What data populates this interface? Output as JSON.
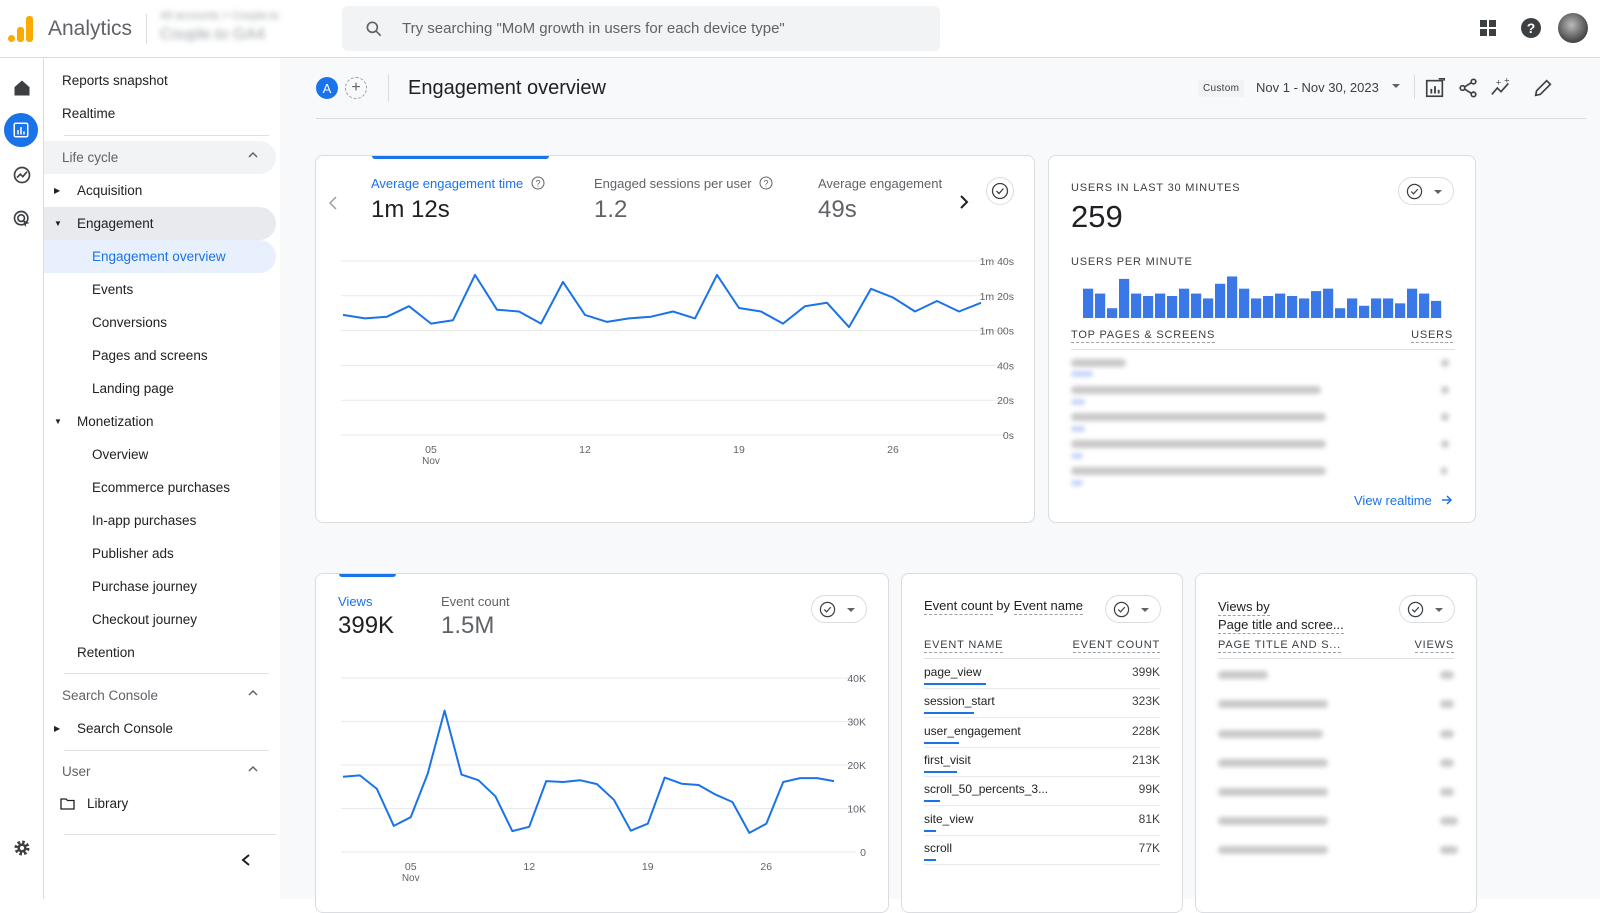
{
  "topbar": {
    "app_title": "Analytics",
    "account_line1": "All accounts > Couple.to",
    "account_line2": "Couple.to GA4",
    "search_placeholder": "Try searching \"MoM growth in users for each device type\"",
    "icons": [
      "apps-grid-icon",
      "help-icon",
      "user-avatar"
    ]
  },
  "rail": {
    "items": [
      {
        "name": "home",
        "active": false
      },
      {
        "name": "reports",
        "active": true
      },
      {
        "name": "explore",
        "active": false
      },
      {
        "name": "advertising",
        "active": false
      }
    ],
    "settings_icon": "gear-icon"
  },
  "sidenav": {
    "top_items": [
      "Reports snapshot",
      "Realtime"
    ],
    "sections": [
      {
        "title": "Life cycle",
        "items": [
          {
            "label": "Acquisition",
            "expanded": false
          },
          {
            "label": "Engagement",
            "expanded": true,
            "children": [
              "Engagement overview",
              "Events",
              "Conversions",
              "Pages and screens",
              "Landing page"
            ]
          },
          {
            "label": "Monetization",
            "expanded": true,
            "children": [
              "Overview",
              "Ecommerce purchases",
              "In-app purchases",
              "Publisher ads",
              "Purchase journey",
              "Checkout journey"
            ]
          },
          {
            "label": "Retention"
          }
        ]
      },
      {
        "title": "Search Console",
        "items": [
          {
            "label": "Search Console",
            "expanded": false
          }
        ]
      },
      {
        "title": "User",
        "items": [
          {
            "label": "Library"
          }
        ]
      }
    ],
    "selected": "Engagement overview"
  },
  "header": {
    "comparison_chip": "A",
    "page_title": "Engagement overview",
    "date_tag": "Custom",
    "date_range": "Nov 1 - Nov 30, 2023"
  },
  "engagement_card": {
    "metrics": [
      {
        "label": "Average engagement time",
        "value": "1m 12s",
        "active": true
      },
      {
        "label": "Engaged sessions per user",
        "value": "1.2",
        "active": false
      },
      {
        "label": "Average engagement",
        "value": "49s",
        "active": false
      }
    ]
  },
  "realtime_card": {
    "title": "USERS IN LAST 30 MINUTES",
    "value": "259",
    "subtitle": "USERS PER MINUTE",
    "table_col1": "TOP PAGES & SCREENS",
    "table_col2": "USERS",
    "link": "View realtime",
    "per_minute": [
      6,
      5,
      2,
      8,
      5,
      4.5,
      5,
      4.5,
      6,
      5,
      4,
      7,
      8.5,
      6,
      4,
      4.5,
      5,
      4.5,
      4,
      5.5,
      6,
      2,
      4,
      2.5,
      4,
      4,
      3,
      6,
      5,
      3.5
    ]
  },
  "views_card": {
    "metrics": [
      {
        "label": "Views",
        "value": "399K",
        "active": true
      },
      {
        "label": "Event count",
        "value": "1.5M",
        "active": false
      }
    ]
  },
  "events_card": {
    "title_part1": "Event count",
    "title_by": "by",
    "title_part2": "Event name",
    "col1": "EVENT NAME",
    "col2": "EVENT COUNT",
    "rows": [
      {
        "name": "page_view",
        "value": "399K",
        "share": 1.0
      },
      {
        "name": "session_start",
        "value": "323K",
        "share": 0.81
      },
      {
        "name": "user_engagement",
        "value": "228K",
        "share": 0.57
      },
      {
        "name": "first_visit",
        "value": "213K",
        "share": 0.53
      },
      {
        "name": "scroll_50_percents_3...",
        "value": "99K",
        "share": 0.25
      },
      {
        "name": "site_view",
        "value": "81K",
        "share": 0.2
      },
      {
        "name": "scroll",
        "value": "77K",
        "share": 0.19
      }
    ]
  },
  "pages_card": {
    "title_line1": "Views by",
    "title_line2": "Page title and scree...",
    "col1": "PAGE TITLE AND S...",
    "col2": "VIEWS"
  },
  "chart_data": [
    {
      "type": "line",
      "title": "Average engagement time",
      "x": [
        "Nov 1",
        "Nov 2",
        "Nov 3",
        "Nov 4",
        "Nov 5",
        "Nov 6",
        "Nov 7",
        "Nov 8",
        "Nov 9",
        "Nov 10",
        "Nov 11",
        "Nov 12",
        "Nov 13",
        "Nov 14",
        "Nov 15",
        "Nov 16",
        "Nov 17",
        "Nov 18",
        "Nov 19",
        "Nov 20",
        "Nov 21",
        "Nov 22",
        "Nov 23",
        "Nov 24",
        "Nov 25",
        "Nov 26",
        "Nov 27",
        "Nov 28",
        "Nov 29",
        "Nov 30"
      ],
      "series": [
        {
          "name": "Average engagement time (s)",
          "values": [
            69,
            67,
            68,
            74,
            64,
            66,
            92,
            72,
            71,
            64,
            88,
            69,
            65,
            67,
            68,
            71,
            67,
            92,
            73,
            71,
            64,
            74,
            76,
            62,
            84,
            79,
            71,
            77,
            71,
            76
          ]
        }
      ],
      "xticks": [
        {
          "day": 5,
          "label": "05",
          "sub": "Nov"
        },
        {
          "day": 12,
          "label": "12"
        },
        {
          "day": 19,
          "label": "19"
        },
        {
          "day": 26,
          "label": "26"
        }
      ],
      "yticks": [
        {
          "v": 100,
          "label": "1m 40s"
        },
        {
          "v": 80,
          "label": "1m 20s"
        },
        {
          "v": 60,
          "label": "1m 00s"
        },
        {
          "v": 40,
          "label": "40s"
        },
        {
          "v": 20,
          "label": "20s"
        },
        {
          "v": 0,
          "label": "0s"
        }
      ],
      "ylim": [
        0,
        100
      ],
      "grid": true,
      "color": "#1a73e8"
    },
    {
      "type": "line",
      "title": "Views",
      "x": [
        "Nov 1",
        "Nov 2",
        "Nov 3",
        "Nov 4",
        "Nov 5",
        "Nov 6",
        "Nov 7",
        "Nov 8",
        "Nov 9",
        "Nov 10",
        "Nov 11",
        "Nov 12",
        "Nov 13",
        "Nov 14",
        "Nov 15",
        "Nov 16",
        "Nov 17",
        "Nov 18",
        "Nov 19",
        "Nov 20",
        "Nov 21",
        "Nov 22",
        "Nov 23",
        "Nov 24",
        "Nov 25",
        "Nov 26",
        "Nov 27",
        "Nov 28",
        "Nov 29",
        "Nov 30"
      ],
      "series": [
        {
          "name": "Views",
          "values": [
            17300,
            17600,
            14500,
            6000,
            8000,
            18000,
            32500,
            17800,
            16500,
            12800,
            4800,
            5800,
            16300,
            16100,
            16500,
            15600,
            12000,
            4900,
            6500,
            17100,
            15700,
            15400,
            13200,
            11500,
            4400,
            6500,
            16100,
            17000,
            17000,
            16300
          ]
        }
      ],
      "xticks": [
        {
          "day": 5,
          "label": "05",
          "sub": "Nov"
        },
        {
          "day": 12,
          "label": "12"
        },
        {
          "day": 19,
          "label": "19"
        },
        {
          "day": 26,
          "label": "26"
        }
      ],
      "yticks": [
        {
          "v": 40000,
          "label": "40K"
        },
        {
          "v": 30000,
          "label": "30K"
        },
        {
          "v": 20000,
          "label": "20K"
        },
        {
          "v": 10000,
          "label": "10K"
        },
        {
          "v": 0,
          "label": "0"
        }
      ],
      "ylim": [
        0,
        40000
      ],
      "grid": true,
      "color": "#1a73e8"
    }
  ]
}
